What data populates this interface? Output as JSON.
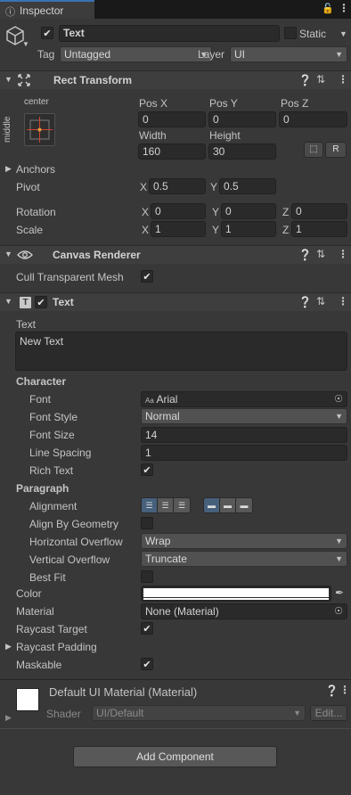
{
  "tab": {
    "title": "Inspector"
  },
  "gameobject": {
    "name": "Text",
    "static_label": "Static",
    "tag_label": "Tag",
    "tag_value": "Untagged",
    "layer_label": "Layer",
    "layer_value": "UI",
    "active": true
  },
  "rect_transform": {
    "title": "Rect Transform",
    "anchor_h": "center",
    "anchor_v": "middle",
    "pos_x_label": "Pos X",
    "pos_y_label": "Pos Y",
    "pos_z_label": "Pos Z",
    "pos_x": "0",
    "pos_y": "0",
    "pos_z": "0",
    "width_label": "Width",
    "height_label": "Height",
    "width": "160",
    "height": "30",
    "r_button": "R",
    "anchors_label": "Anchors",
    "pivot_label": "Pivot",
    "pivot_x": "0.5",
    "pivot_y": "0.5",
    "rotation_label": "Rotation",
    "rot_x": "0",
    "rot_y": "0",
    "rot_z": "0",
    "scale_label": "Scale",
    "scale_x": "1",
    "scale_y": "1",
    "scale_z": "1",
    "x_label": "X",
    "y_label": "Y",
    "z_label": "Z"
  },
  "canvas_renderer": {
    "title": "Canvas Renderer",
    "cull_label": "Cull Transparent Mesh",
    "cull": true
  },
  "text_component": {
    "title": "Text",
    "enabled": true,
    "text_label": "Text",
    "text_value": "New Text",
    "character_label": "Character",
    "font_label": "Font",
    "font_value": "Arial",
    "font_prefix": "Aa",
    "font_style_label": "Font Style",
    "font_style_value": "Normal",
    "font_size_label": "Font Size",
    "font_size_value": "14",
    "line_spacing_label": "Line Spacing",
    "line_spacing_value": "1",
    "rich_text_label": "Rich Text",
    "rich_text": true,
    "paragraph_label": "Paragraph",
    "alignment_label": "Alignment",
    "align_by_geometry_label": "Align By Geometry",
    "align_by_geometry": false,
    "horizontal_overflow_label": "Horizontal Overflow",
    "horizontal_overflow_value": "Wrap",
    "vertical_overflow_label": "Vertical Overflow",
    "vertical_overflow_value": "Truncate",
    "best_fit_label": "Best Fit",
    "best_fit": false,
    "color_label": "Color",
    "color_value": "#ffffff",
    "material_label": "Material",
    "material_value": "None (Material)",
    "raycast_target_label": "Raycast Target",
    "raycast_target": true,
    "raycast_padding_label": "Raycast Padding",
    "maskable_label": "Maskable",
    "maskable": true
  },
  "material_section": {
    "title": "Default UI Material (Material)",
    "shader_label": "Shader",
    "shader_value": "UI/Default",
    "edit_button": "Edit..."
  },
  "add_component": {
    "label": "Add Component"
  },
  "colors": {
    "accent": "#3a72b0",
    "panel": "#383838",
    "header": "#3e3e3e",
    "field": "#2a2a2a"
  }
}
